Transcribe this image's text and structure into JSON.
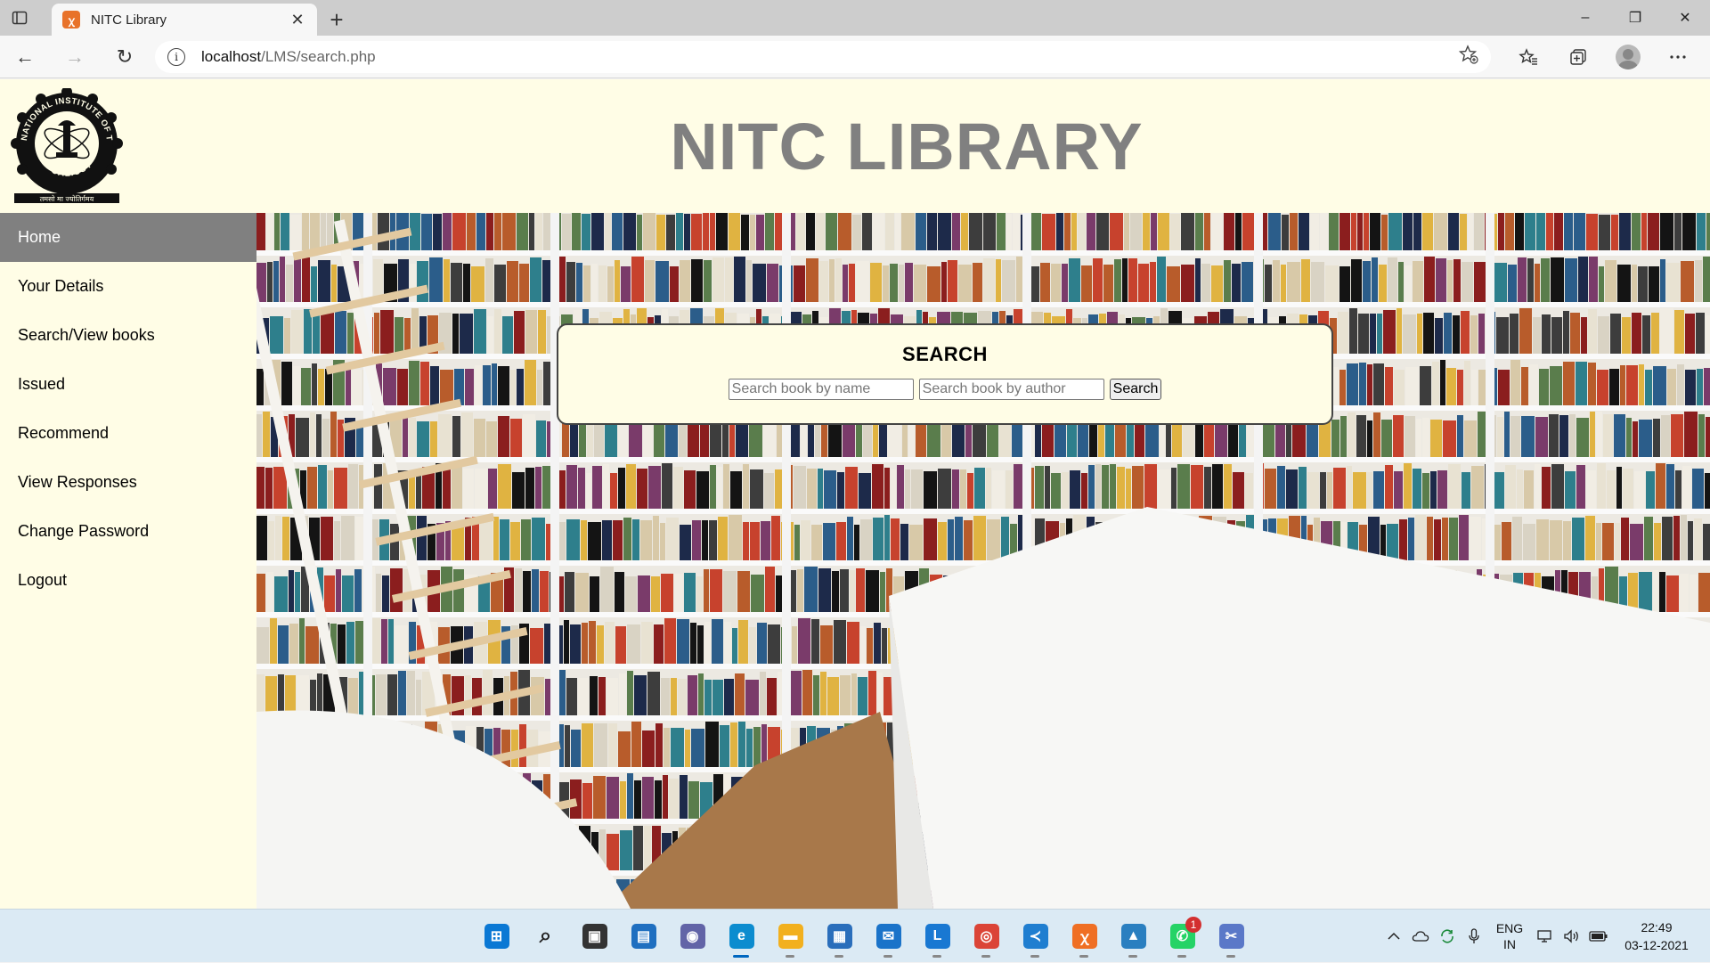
{
  "browser": {
    "tab_title": "NITC Library",
    "tab_favicon_glyph": "ꭓ",
    "close_glyph": "✕",
    "newtab_glyph": "+",
    "url_host": "localhost",
    "url_path": "/LMS/search.php",
    "info_glyph": "i",
    "window": {
      "minimize": "–",
      "restore": "❐",
      "close": "✕"
    },
    "nav": {
      "back": "←",
      "forward": "→",
      "refresh": "↻"
    },
    "icons": [
      "add-favorite-icon",
      "favorites-icon",
      "collections-icon",
      "profile-icon",
      "more-icon"
    ]
  },
  "page": {
    "title": "NITC LIBRARY",
    "logo": {
      "ring_top_text": "NATIONAL INSTITUTE OF TECHNOLOGY",
      "ring_bottom_text": "CALICUT",
      "motto": "तमसो मा ज्योतिर्गमय"
    },
    "sidebar": [
      {
        "label": "Home",
        "active": true
      },
      {
        "label": "Your Details"
      },
      {
        "label": "Search/View books"
      },
      {
        "label": "Issued"
      },
      {
        "label": "Recommend"
      },
      {
        "label": "View Responses"
      },
      {
        "label": "Change Password"
      },
      {
        "label": "Logout"
      }
    ],
    "search": {
      "heading": "SEARCH",
      "name_placeholder": "Search book by name",
      "author_placeholder": "Search book by author",
      "button_label": "Search"
    },
    "colors": {
      "page_bg": "#fffde6",
      "title_gray": "#808080",
      "active_nav": "#808080"
    }
  },
  "taskbar": {
    "apps": [
      {
        "name": "start-icon",
        "color": "#0a78d4",
        "glyph": "⊞"
      },
      {
        "name": "search-icon",
        "color": "transparent",
        "glyph": "⌕"
      },
      {
        "name": "task-view-icon",
        "color": "#333",
        "glyph": "▣"
      },
      {
        "name": "widgets-icon",
        "color": "#1f6fc0",
        "glyph": "▤"
      },
      {
        "name": "teams-chat-icon",
        "color": "#6264a7",
        "glyph": "◉"
      },
      {
        "name": "edge-icon",
        "color": "#0c8ccf",
        "glyph": "e",
        "active": true
      },
      {
        "name": "file-explorer-icon",
        "color": "#f2b01e",
        "glyph": "▬"
      },
      {
        "name": "microsoft-store-icon",
        "color": "#2a6ebb",
        "glyph": "▦"
      },
      {
        "name": "mail-icon",
        "color": "#1a73c9",
        "glyph": "✉"
      },
      {
        "name": "app-l-icon",
        "color": "#1978d2",
        "glyph": "L"
      },
      {
        "name": "chrome-icon",
        "color": "#db4437",
        "glyph": "◎"
      },
      {
        "name": "vscode-icon",
        "color": "#1f7ed0",
        "glyph": "≺"
      },
      {
        "name": "xampp-icon",
        "color": "#ef6f24",
        "glyph": "ꭓ"
      },
      {
        "name": "photos-icon",
        "color": "#2a7fc0",
        "glyph": "▲"
      },
      {
        "name": "whatsapp-icon",
        "color": "#25d366",
        "glyph": "✆",
        "badge": "1"
      },
      {
        "name": "snipping-tool-icon",
        "color": "#5a78c8",
        "glyph": "✂"
      }
    ],
    "tray": {
      "lang_top": "ENG",
      "lang_bottom": "IN",
      "time": "22:49",
      "date": "03-12-2021"
    }
  }
}
